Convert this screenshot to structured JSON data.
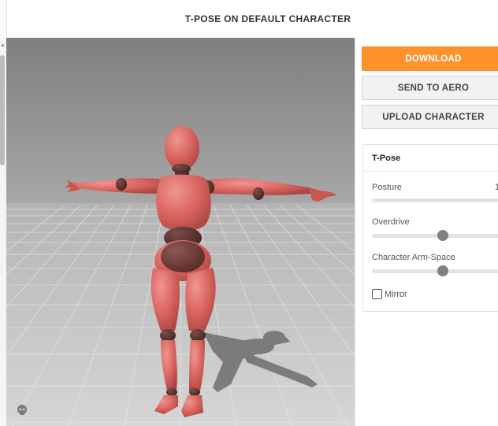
{
  "header": {
    "title": "T-POSE ON DEFAULT CHARACTER"
  },
  "actions": {
    "download_label": "DOWNLOAD",
    "send_label": "SEND TO AERO",
    "upload_label": "UPLOAD CHARACTER"
  },
  "settings": {
    "title": "T-Pose",
    "posture": {
      "label": "Posture",
      "value": "1",
      "level": 1.0
    },
    "overdrive": {
      "label": "Overdrive",
      "level": 0.5
    },
    "arm_space": {
      "label": "Character Arm-Space",
      "level": 0.5
    },
    "mirror": {
      "label": "Mirror",
      "checked": false
    }
  },
  "colors": {
    "accent": "#ff922b",
    "character": "#d9645e",
    "joints": "#5a3532",
    "floor": "#c9c9c9",
    "sky": "#8c8c8c"
  },
  "icons": {
    "viewport_badge": "skull-icon",
    "scroll": "scroll-up-arrow-icon"
  }
}
